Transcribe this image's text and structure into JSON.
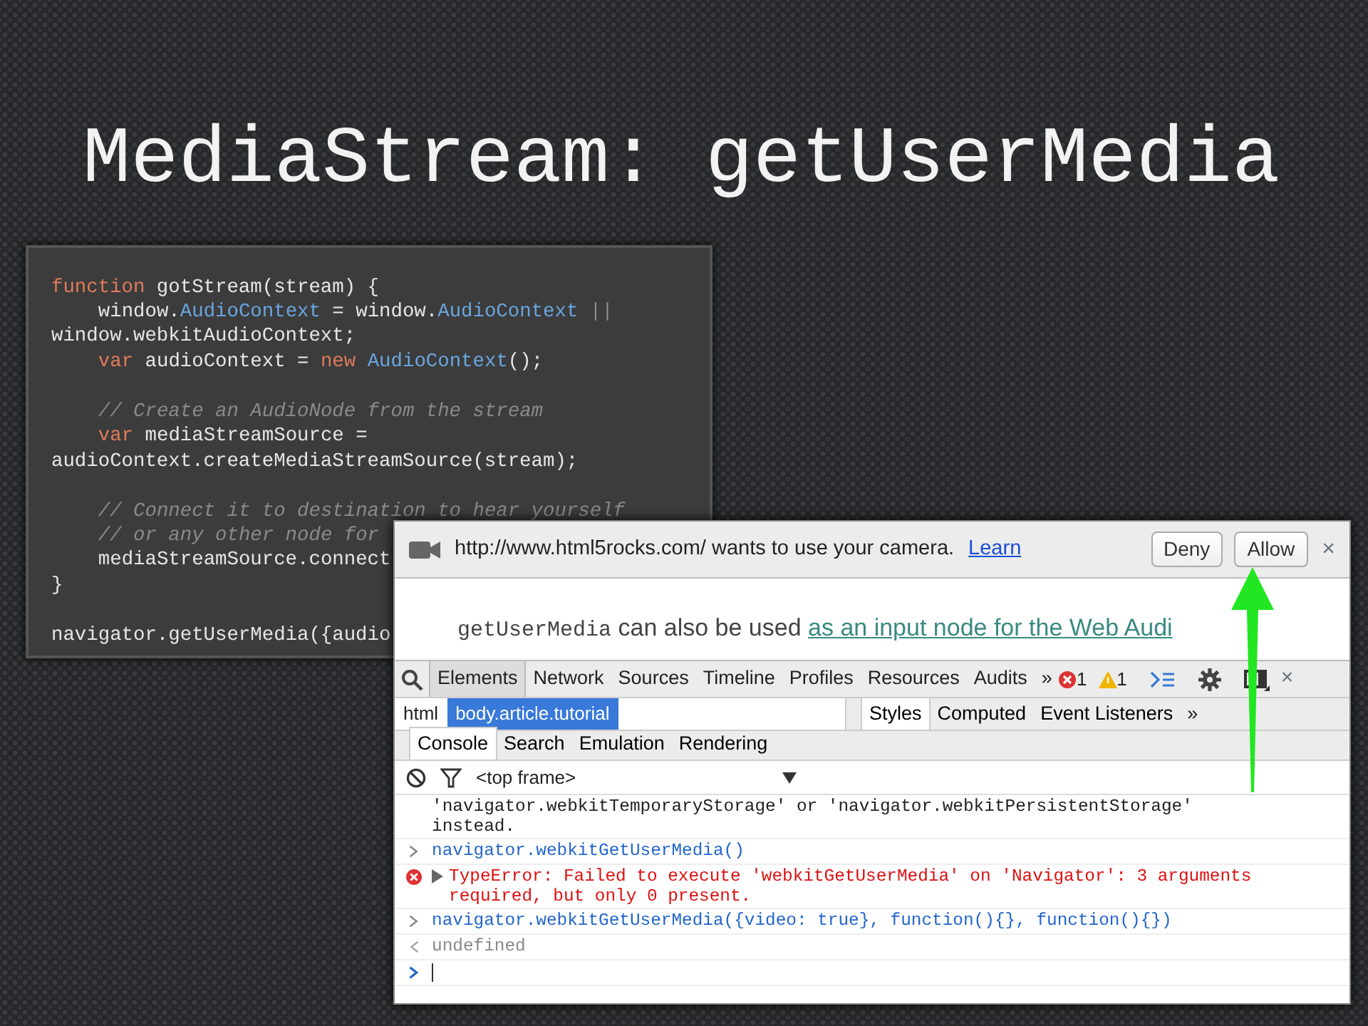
{
  "slide": {
    "title": "MediaStream: getUserMedia"
  },
  "code": {
    "lines": [
      {
        "indent": false,
        "space_before": false,
        "tokens": [
          {
            "text": "function",
            "kind": "keyword"
          },
          {
            "text": " gotStream(stream) {",
            "kind": "plain"
          }
        ]
      },
      {
        "indent": true,
        "space_before": false,
        "tokens": [
          {
            "text": "window.",
            "kind": "plain"
          },
          {
            "text": "AudioContext",
            "kind": "type"
          },
          {
            "text": " = window.",
            "kind": "plain"
          },
          {
            "text": "AudioContext",
            "kind": "type"
          },
          {
            "text": " ||",
            "kind": "comment"
          }
        ]
      },
      {
        "indent": false,
        "space_before": false,
        "tokens": [
          {
            "text": "window.webkitAudioContext;",
            "kind": "plain"
          }
        ]
      },
      {
        "indent": true,
        "space_before": false,
        "tokens": [
          {
            "text": "var",
            "kind": "keyword"
          },
          {
            "text": " audioContext = ",
            "kind": "plain"
          },
          {
            "text": "new",
            "kind": "keyword"
          },
          {
            "text": " AudioContext",
            "kind": "type"
          },
          {
            "text": "();",
            "kind": "plain"
          }
        ]
      },
      {
        "indent": true,
        "space_before": true,
        "tokens": [
          {
            "text": "// Create an AudioNode from the stream",
            "kind": "comment"
          }
        ]
      },
      {
        "indent": true,
        "space_before": false,
        "tokens": [
          {
            "text": "var",
            "kind": "keyword"
          },
          {
            "text": " mediaStreamSource =",
            "kind": "plain"
          }
        ]
      },
      {
        "indent": false,
        "space_before": false,
        "tokens": [
          {
            "text": "audioContext.createMediaStreamSource(stream);",
            "kind": "plain"
          }
        ]
      },
      {
        "indent": true,
        "space_before": true,
        "tokens": [
          {
            "text": "// Connect it to destination to hear yourself",
            "kind": "comment"
          }
        ]
      },
      {
        "indent": true,
        "space_before": false,
        "tokens": [
          {
            "text": "// or any other node for",
            "kind": "comment"
          }
        ]
      },
      {
        "indent": true,
        "space_before": false,
        "tokens": [
          {
            "text": "mediaStreamSource.connect",
            "kind": "plain"
          }
        ]
      },
      {
        "indent": false,
        "space_before": false,
        "tokens": [
          {
            "text": "}",
            "kind": "plain"
          }
        ]
      },
      {
        "indent": false,
        "space_before": true,
        "tokens": [
          {
            "text": "navigator.getUserMedia({audio",
            "kind": "plain"
          }
        ]
      }
    ]
  },
  "browser": {
    "infobar": {
      "message": "http://www.html5rocks.com/ wants to use your camera.",
      "link": "Learn",
      "buttons": [
        "Deny",
        "Allow"
      ],
      "close": "×"
    },
    "page": {
      "code": "getUserMedia",
      "text": " can also be used ",
      "link": "as an input node for the Web Audi"
    },
    "devtools": {
      "tabs": [
        {
          "label": "Elements",
          "selected": true
        },
        {
          "label": "Network",
          "selected": false
        },
        {
          "label": "Sources",
          "selected": false
        },
        {
          "label": "Timeline",
          "selected": false
        },
        {
          "label": "Profiles",
          "selected": false
        },
        {
          "label": "Resources",
          "selected": false
        },
        {
          "label": "Audits",
          "selected": false
        }
      ],
      "more": "»",
      "errors": "1",
      "warnings": "1",
      "close": "×",
      "breadcrumbs": [
        {
          "label": "html",
          "selected": false
        },
        {
          "label": "body.article.tutorial",
          "selected": true
        }
      ],
      "side_tabs": [
        {
          "label": "Styles",
          "selected": true
        },
        {
          "label": "Computed",
          "selected": false
        },
        {
          "label": "Event Listeners",
          "selected": false
        }
      ],
      "side_more": "»",
      "drawer_tabs": [
        {
          "label": "Console",
          "selected": true
        },
        {
          "label": "Search",
          "selected": false
        },
        {
          "label": "Emulation",
          "selected": false
        },
        {
          "label": "Rendering",
          "selected": false
        }
      ],
      "frame": "<top frame>",
      "messages": [
        {
          "kind": "log",
          "text": "'navigator.webkitTemporaryStorage' or 'navigator.webkitPersistentStorage' instead."
        },
        {
          "kind": "input",
          "text": "navigator.webkitGetUserMedia()"
        },
        {
          "kind": "error",
          "text": "TypeError: Failed to execute 'webkitGetUserMedia' on 'Navigator': 3 arguments required, but only 0 present."
        },
        {
          "kind": "input",
          "text": "navigator.webkitGetUserMedia({video: true}, function(){}, function(){})"
        },
        {
          "kind": "result",
          "text": "undefined"
        },
        {
          "kind": "prompt"
        }
      ]
    }
  }
}
